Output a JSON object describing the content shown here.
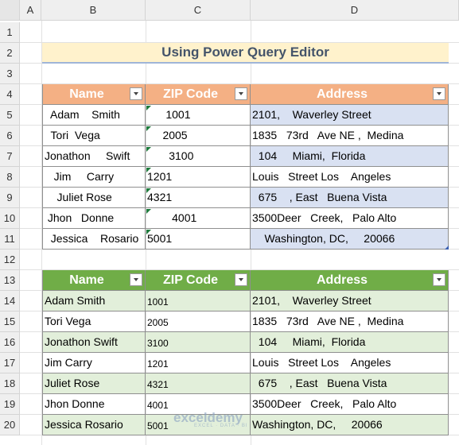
{
  "columns": [
    "A",
    "B",
    "C",
    "D"
  ],
  "rows": [
    "1",
    "2",
    "3",
    "4",
    "5",
    "6",
    "7",
    "8",
    "9",
    "10",
    "11",
    "12",
    "13",
    "14",
    "15",
    "16",
    "17",
    "18",
    "19",
    "20"
  ],
  "title": "Using Power Query Editor",
  "table1": {
    "headers": [
      "Name",
      "ZIP Code",
      "Address"
    ],
    "rows": [
      {
        "name": "  Adam    Smith",
        "zip": "      1001",
        "addr": "2101,    Waverley Street"
      },
      {
        "name": "  Tori  Vega",
        "zip": "     2005",
        "addr": "1835   73rd   Ave NE ,  Medina"
      },
      {
        "name": "Jonathon     Swift",
        "zip": "       3100",
        "addr": "  104     Miami,  Florida"
      },
      {
        "name": "   Jim     Carry",
        "zip": "1201",
        "addr": "Louis   Street Los    Angeles"
      },
      {
        "name": "    Juliet Rose",
        "zip": "4321",
        "addr": "  675    , East   Buena Vista"
      },
      {
        "name": " Jhon   Donne",
        "zip": "        4001",
        "addr": "3500Deer   Creek,   Palo Alto"
      },
      {
        "name": "  Jessica    Rosario",
        "zip": "5001",
        "addr": "    Washington, DC,     20066"
      }
    ]
  },
  "table2": {
    "headers": [
      "Name",
      "ZIP Code",
      "Address"
    ],
    "rows": [
      {
        "name": "Adam Smith",
        "zip": "1001",
        "addr": "2101,    Waverley Street"
      },
      {
        "name": "Tori Vega",
        "zip": "2005",
        "addr": "1835   73rd   Ave NE ,  Medina"
      },
      {
        "name": "Jonathon Swift",
        "zip": "3100",
        "addr": "  104     Miami,  Florida"
      },
      {
        "name": "Jim Carry",
        "zip": "1201",
        "addr": "Louis   Street Los    Angeles"
      },
      {
        "name": "Juliet Rose",
        "zip": "4321",
        "addr": "  675    , East   Buena Vista"
      },
      {
        "name": "Jhon Donne",
        "zip": "4001",
        "addr": "3500Deer   Creek,   Palo Alto"
      },
      {
        "name": "Jessica Rosario",
        "zip": "5001",
        "addr": "Washington, DC,     20066"
      }
    ]
  },
  "watermark": {
    "brand": "exceldemy",
    "tagline": "EXCEL · DATA · BI"
  },
  "colors": {
    "table1_header": "#f4b084",
    "table2_header": "#70ad47",
    "title_fill": "#fff2cc",
    "stripe": "#e2efda"
  }
}
